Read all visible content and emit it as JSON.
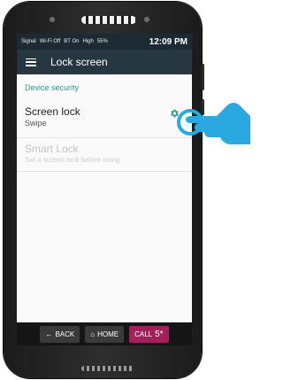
{
  "statusbar": {
    "signal": "Signal",
    "wifi": "Wi-Fi Off",
    "bt": "BT On",
    "volume": "High",
    "battery": "55%",
    "time": "12:09 PM"
  },
  "appbar": {
    "title": "Lock screen"
  },
  "section": {
    "header": "Device security"
  },
  "rows": [
    {
      "title": "Screen lock",
      "subtitle": "Swipe",
      "enabled": true
    },
    {
      "title": "Smart Lock",
      "subtitle": "Set a screen lock before using",
      "enabled": false
    }
  ],
  "navbar": {
    "back": "BACK",
    "home": "HOME",
    "call": "CALL",
    "call_suffix": "5*"
  },
  "colors": {
    "accent": "#2c9a8a",
    "appbar": "#263742",
    "call": "#a3215b",
    "hand": "#29a9e0"
  }
}
